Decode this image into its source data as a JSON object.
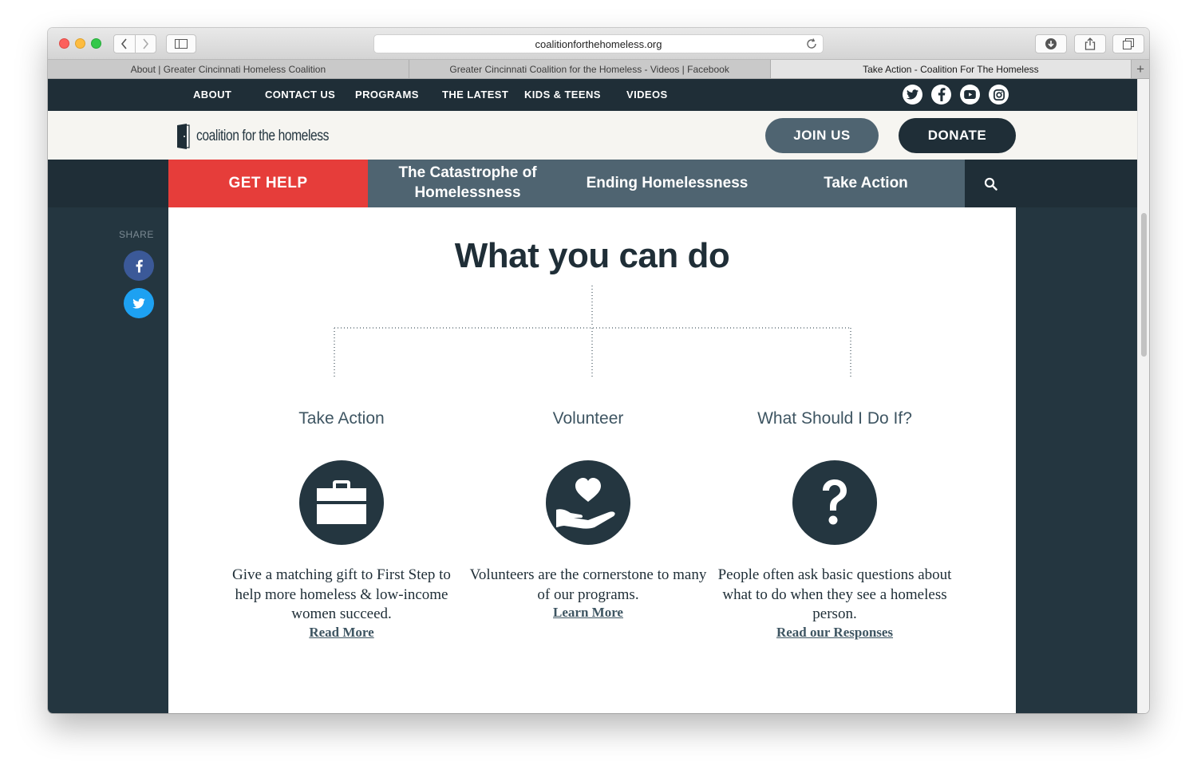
{
  "browser": {
    "url": "coalitionforthehomeless.org",
    "tabs": [
      {
        "title": "About | Greater Cincinnati Homeless Coalition"
      },
      {
        "title": "Greater Cincinnati Coalition for the Homeless - Videos | Facebook"
      },
      {
        "title": "Take Action - Coalition For The Homeless"
      }
    ],
    "new_tab_label": "+"
  },
  "topnav": {
    "links": [
      "ABOUT",
      "CONTACT US",
      "PROGRAMS",
      "THE LATEST",
      "KIDS & TEENS",
      "VIDEOS"
    ],
    "social": [
      "twitter-icon",
      "facebook-icon",
      "youtube-icon",
      "instagram-icon"
    ]
  },
  "header": {
    "logo_text": "coalition for the homeless",
    "join_label": "JOIN US",
    "donate_label": "DONATE"
  },
  "mainnav": {
    "get_help": "GET HELP",
    "catastrophe_line1": "The Catastrophe of",
    "catastrophe_line2": "Homelessness",
    "ending": "Ending Homelessness",
    "take_action": "Take Action"
  },
  "share": {
    "label": "SHARE"
  },
  "main": {
    "heading": "What you can do",
    "columns": [
      {
        "title": "Take Action",
        "icon": "briefcase-icon",
        "text": "Give a matching gift to First Step to help more homeless & low-income women succeed.",
        "link": "Read More"
      },
      {
        "title": "Volunteer",
        "icon": "hand-heart-icon",
        "text": "Volunteers are the cornerstone to many of our programs.",
        "link": "Learn More"
      },
      {
        "title": "What Should I Do If?",
        "icon": "question-mark-icon",
        "text": "People often ask basic questions about what to do when they see a homeless person.",
        "link": "Read our Responses"
      }
    ]
  },
  "colors": {
    "dark_navy": "#1f2e37",
    "slate": "#4f6471",
    "red": "#e63d3a",
    "cream": "#f6f5f1"
  }
}
